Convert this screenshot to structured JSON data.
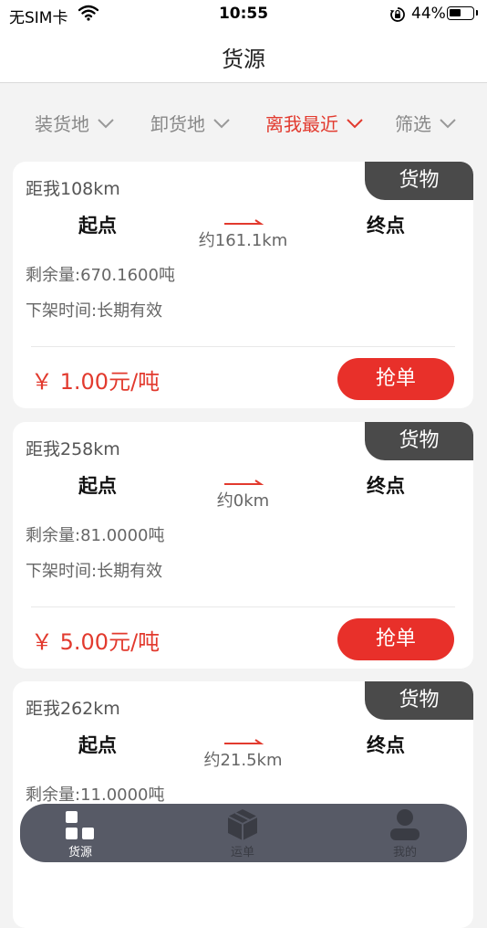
{
  "status_bar": {
    "carrier": "无SIM卡",
    "time": "10:55",
    "battery": "44%",
    "battery_level": 0.44,
    "icons": [
      "wifi-icon",
      "orientation-lock-icon",
      "battery-icon"
    ]
  },
  "nav": {
    "title": "货源"
  },
  "filters": [
    {
      "label": "装货地",
      "active": false
    },
    {
      "label": "卸货地",
      "active": false
    },
    {
      "label": "离我最近",
      "active": true
    },
    {
      "label": "筛选",
      "active": false
    }
  ],
  "colors": {
    "accent": "#e23a2e",
    "button": "#e8302a",
    "tag_bg": "#4a4a4a",
    "tab_bar_bg": "#575a66"
  },
  "cards": [
    {
      "tag": "货物",
      "distance": "距我108km",
      "origin": "起点",
      "destination": "终点",
      "route_distance": "约161.1km",
      "remaining": "剩余量:670.1600吨",
      "expiry": "下架时间:长期有效",
      "price": "￥ 1.00元/吨",
      "button": "抢单"
    },
    {
      "tag": "货物",
      "distance": "距我258km",
      "origin": "起点",
      "destination": "终点",
      "route_distance": "约0km",
      "remaining": "剩余量:81.0000吨",
      "expiry": "下架时间:长期有效",
      "price": "￥ 5.00元/吨",
      "button": "抢单"
    },
    {
      "tag": "货物",
      "distance": "距我262km",
      "origin": "起点",
      "destination": "终点",
      "route_distance": "约21.5km",
      "remaining": "剩余量:11.0000吨",
      "expiry": "",
      "price": "",
      "button": ""
    }
  ],
  "tabs": [
    {
      "label": "货源",
      "icon": "grid-icon",
      "active": true
    },
    {
      "label": "运单",
      "icon": "package-icon",
      "active": false
    },
    {
      "label": "我的",
      "icon": "person-icon",
      "active": false
    }
  ]
}
